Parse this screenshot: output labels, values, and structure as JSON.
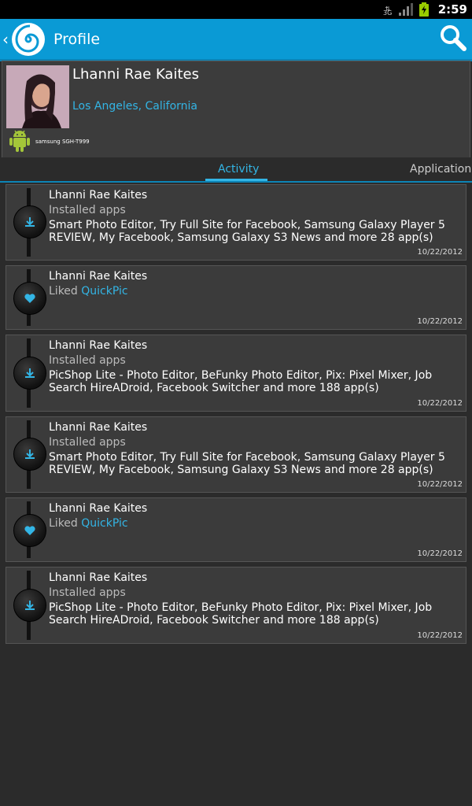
{
  "status_bar": {
    "network_label": "3G",
    "time": "2:59",
    "colors": {
      "battery": "#99cc00"
    }
  },
  "action_bar": {
    "title": "Profile",
    "back_icon": "chevron-left-icon",
    "logo_icon": "spiral-logo-icon",
    "search_icon": "search-icon",
    "color": "#0a9ad5"
  },
  "profile": {
    "name": "Lhanni Rae Kaites",
    "location": "Los Angeles, California",
    "device": "samsung SGH-T999",
    "device_icon": "android-robot-icon"
  },
  "tabs": [
    {
      "label": "Activity",
      "selected": true
    },
    {
      "label": "Applications",
      "selected": false
    }
  ],
  "feed": [
    {
      "type": "install",
      "icon": "download-icon",
      "user": "Lhanni Rae Kaites",
      "action": "Installed apps",
      "target": "",
      "details": "Smart Photo Editor, Try Full Site for Facebook, Samsung Galaxy Player 5 REVIEW, My Facebook, Samsung Galaxy S3 News and more 28 app(s)",
      "date": "10/22/2012"
    },
    {
      "type": "like",
      "icon": "heart-icon",
      "user": "Lhanni Rae Kaites",
      "action": "Liked",
      "target": "QuickPic",
      "details": "",
      "date": "10/22/2012"
    },
    {
      "type": "install",
      "icon": "download-icon",
      "user": "Lhanni Rae Kaites",
      "action": "Installed apps",
      "target": "",
      "details": "PicShop Lite - Photo Editor, BeFunky Photo Editor, Pix: Pixel Mixer, Job Search HireADroid, Facebook Switcher and more 188 app(s)",
      "date": "10/22/2012"
    },
    {
      "type": "install",
      "icon": "download-icon",
      "user": "Lhanni Rae Kaites",
      "action": "Installed apps",
      "target": "",
      "details": "Smart Photo Editor, Try Full Site for Facebook, Samsung Galaxy Player 5 REVIEW, My Facebook, Samsung Galaxy S3 News and more 28 app(s)",
      "date": "10/22/2012"
    },
    {
      "type": "like",
      "icon": "heart-icon",
      "user": "Lhanni Rae Kaites",
      "action": "Liked",
      "target": "QuickPic",
      "details": "",
      "date": "10/22/2012"
    },
    {
      "type": "install",
      "icon": "download-icon",
      "user": "Lhanni Rae Kaites",
      "action": "Installed apps",
      "target": "",
      "details": "PicShop Lite - Photo Editor, BeFunky Photo Editor, Pix: Pixel Mixer, Job Search HireADroid, Facebook Switcher and more 188 app(s)",
      "date": "10/22/2012"
    }
  ]
}
